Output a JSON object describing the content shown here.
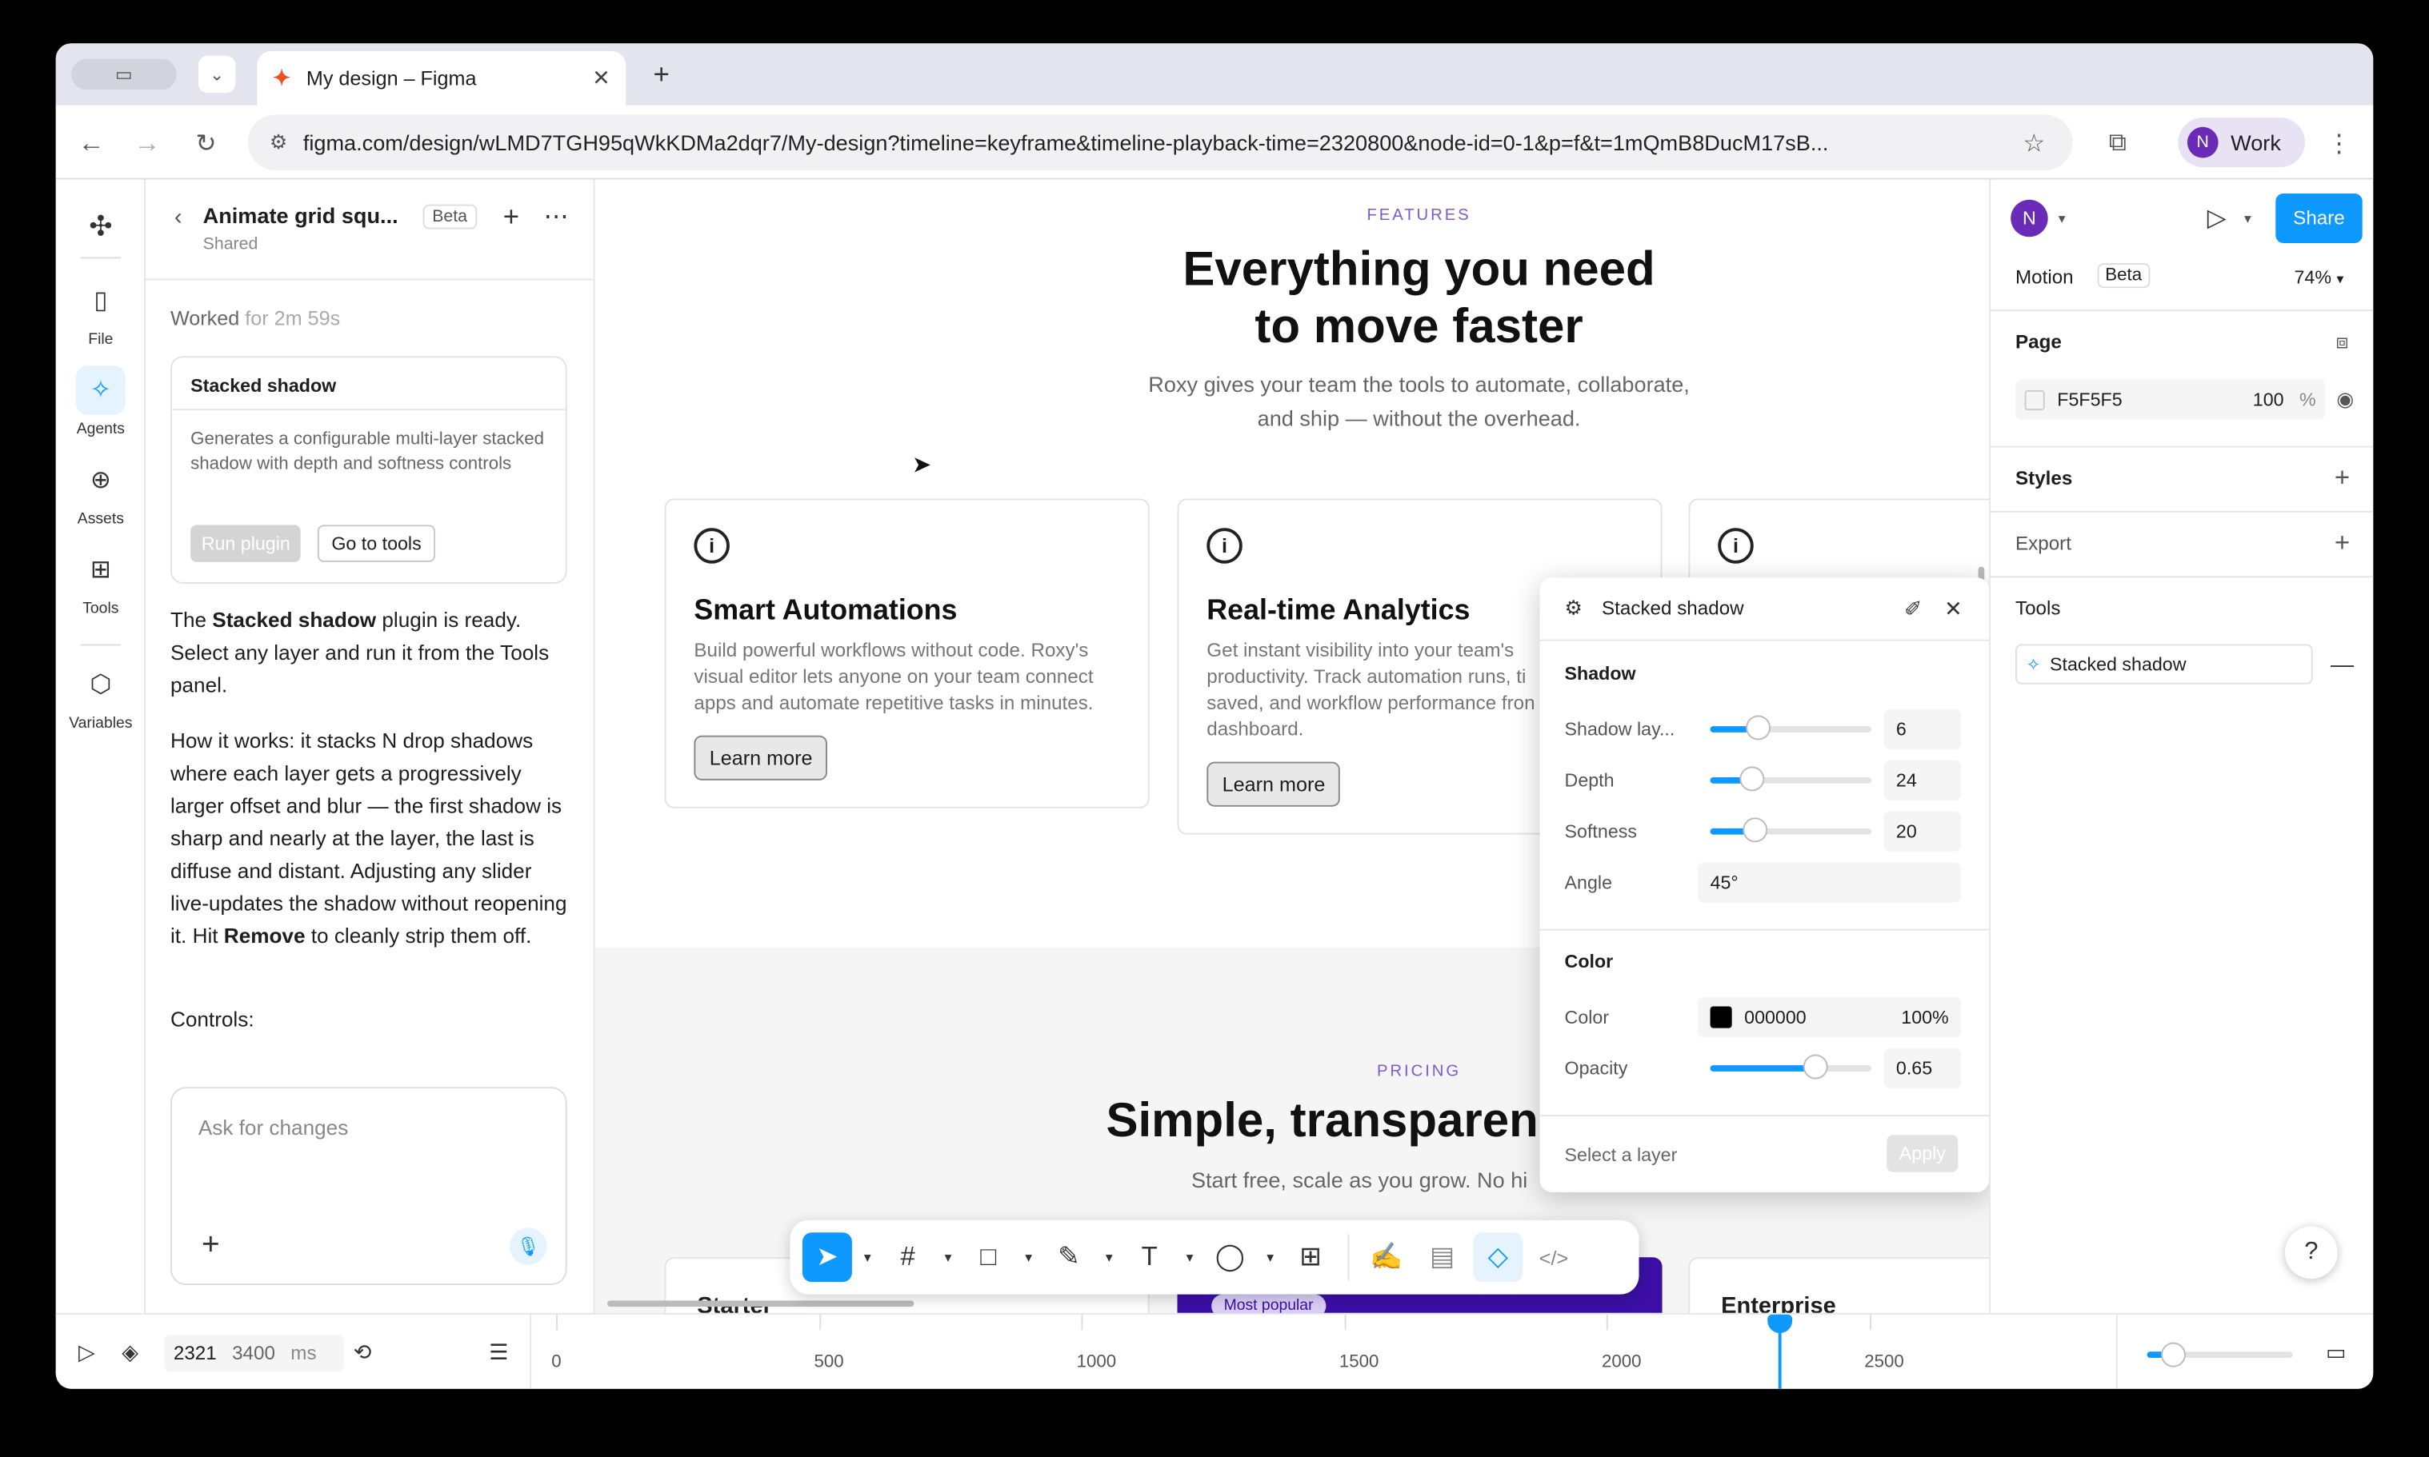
{
  "browser": {
    "tab_title": "My design – Figma",
    "url": "figma.com/design/wLMD7TGH95qWkKDMa2dqr7/My-design?timeline=keyframe&timeline-playback-time=2320800&node-id=0-1&p=f&t=1mQmB8DucM17sB...",
    "profile_initial": "N",
    "profile_label": "Work"
  },
  "rail": {
    "items": [
      {
        "label": "File",
        "icon": "file-icon"
      },
      {
        "label": "Agents",
        "icon": "agents-icon"
      },
      {
        "label": "Assets",
        "icon": "assets-icon"
      },
      {
        "label": "Tools",
        "icon": "tools-icon"
      },
      {
        "label": "Variables",
        "icon": "variables-icon"
      }
    ]
  },
  "chat": {
    "title": "Animate grid squ...",
    "badge": "Beta",
    "subtitle": "Shared",
    "worked_label": "Worked",
    "worked_time": "for 2m 59s",
    "plugin_card": {
      "title": "Stacked shadow",
      "description": "Generates a configurable multi-layer stacked shadow with depth and softness controls",
      "run_label": "Run plugin",
      "tools_label": "Go to tools"
    },
    "msg1_a": "The ",
    "msg1_b": "Stacked shadow",
    "msg1_c": " plugin is ready. Select any layer and run it from the Tools panel.",
    "msg2_a": "How it works: it stacks N drop shadows where each layer gets a progressively larger offset and blur — the first shadow is sharp and nearly at the layer, the last is diffuse and distant. Adjusting any slider live-updates the shadow without reopening it. Hit ",
    "msg2_b": "Remove",
    "msg2_c": " to cleanly strip them off.",
    "controls": "Controls:",
    "input_placeholder": "Ask for changes"
  },
  "canvas": {
    "features_eyebrow": "FEATURES",
    "headline_1": "Everything you need",
    "headline_2": "to move faster",
    "sub_1": "Roxy gives your team the tools to automate, collaborate,",
    "sub_2": "and ship — without the overhead.",
    "cards": [
      {
        "title": "Smart Automations",
        "text": "Build powerful workflows without code. Roxy's visual editor lets anyone on your team connect apps and automate repetitive tasks in minutes.",
        "button": "Learn more"
      },
      {
        "title": "Real-time Analytics",
        "text": "Get instant visibility into your team's productivity. Track automation runs, ti saved, and workflow performance fron dashboard.",
        "button": "Learn more"
      }
    ],
    "pricing_eyebrow": "PRICING",
    "pricing_headline": "Simple, transparen",
    "pricing_sub": "Start free, scale as you grow. No hi",
    "plan_1": "Starter",
    "plan_badge": "Most popular",
    "plan_3": "Enterprise"
  },
  "plugin": {
    "title": "Stacked shadow",
    "shadow_section": "Shadow",
    "rows": [
      {
        "label": "Shadow lay...",
        "value": "6",
        "fill": 0.3
      },
      {
        "label": "Depth",
        "value": "24",
        "fill": 0.26
      },
      {
        "label": "Softness",
        "value": "20",
        "fill": 0.28
      }
    ],
    "angle_label": "Angle",
    "angle_value": "45°",
    "color_section": "Color",
    "color_label": "Color",
    "color_hex": "000000",
    "color_pct": "100%",
    "opacity_label": "Opacity",
    "opacity_value": "0.65",
    "opacity_fill": 0.65,
    "footer_hint": "Select a layer",
    "apply_label": "Apply"
  },
  "right": {
    "user_initial": "N",
    "share_label": "Share",
    "motion_label": "Motion",
    "motion_badge": "Beta",
    "zoom": "74%",
    "page_label": "Page",
    "page_color": "F5F5F5",
    "page_opacity": "100",
    "page_pct": "%",
    "styles_label": "Styles",
    "export_label": "Export",
    "tools_label": "Tools",
    "tool_item": "Stacked shadow"
  },
  "timeline": {
    "current": "2321",
    "total": "3400",
    "unit": "ms",
    "ticks": [
      "0",
      "500",
      "1000",
      "1500",
      "2000",
      "2500"
    ],
    "playhead_ms": 2321,
    "max_ms": 3400
  },
  "colors": {
    "accent": "#0d99ff",
    "purple": "#6a2bb8",
    "eyebrow": "#7b5bd6"
  }
}
